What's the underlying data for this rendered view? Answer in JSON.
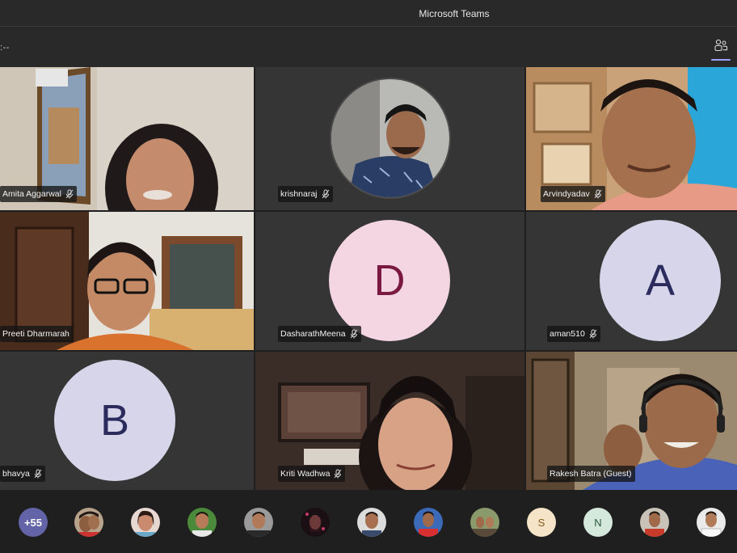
{
  "app": {
    "title": "Microsoft Teams"
  },
  "toolbar": {
    "timer": ":--",
    "participants_icon": "participants-icon"
  },
  "colors": {
    "accent": "#9ea2ff",
    "avatar_lavender": "#d6d5ea",
    "avatar_pink": "#f4d6e3",
    "avatar_text": "#2b2b5e",
    "avatar_pink_text": "#7a1a40"
  },
  "tiles": [
    {
      "name": "Amita Aggarwal",
      "type": "video"
    },
    {
      "name": "krishnaraj",
      "type": "photo"
    },
    {
      "name": "Arvindyadav",
      "type": "video"
    },
    {
      "name": "Preeti Dharmarah",
      "type": "video"
    },
    {
      "name": "DasharathMeena",
      "type": "initial",
      "initial": "D"
    },
    {
      "name": "aman510",
      "type": "initial",
      "initial": "A"
    },
    {
      "name": "bhavya",
      "type": "initial",
      "initial": "B"
    },
    {
      "name": "Kriti Wadhwa",
      "type": "video"
    },
    {
      "name": "Rakesh Batra (Guest)",
      "type": "video"
    }
  ],
  "bottom": {
    "overflow_count": "+55",
    "avatars": [
      {
        "type": "photo"
      },
      {
        "type": "photo"
      },
      {
        "type": "photo"
      },
      {
        "type": "photo"
      },
      {
        "type": "photo"
      },
      {
        "type": "photo"
      },
      {
        "type": "photo"
      },
      {
        "type": "photo"
      },
      {
        "type": "initial",
        "initial": "S"
      },
      {
        "type": "initial",
        "initial": "N"
      },
      {
        "type": "photo"
      },
      {
        "type": "photo"
      }
    ]
  }
}
